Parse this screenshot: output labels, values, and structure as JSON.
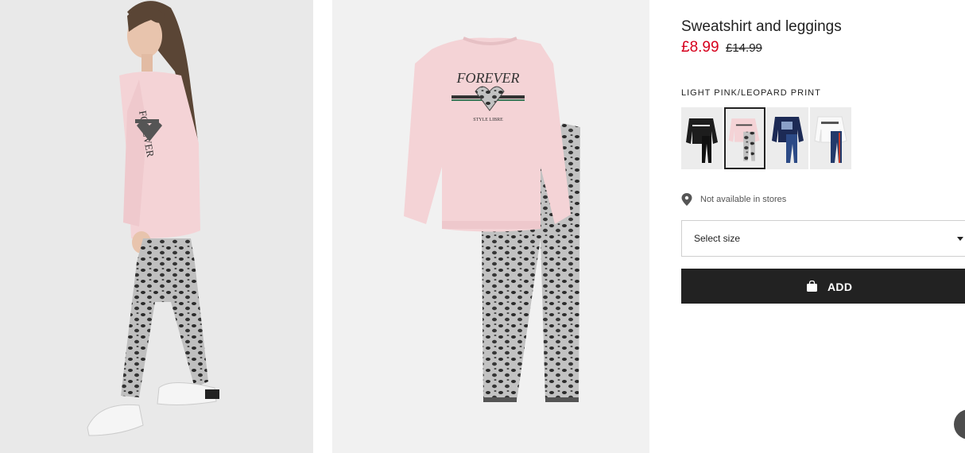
{
  "product": {
    "title": "Sweatshirt and leggings",
    "sale_price": "£8.99",
    "old_price": "£14.99",
    "colour_name": "LIGHT PINK/LEOPARD PRINT",
    "sweatshirt_print": "FOREVER",
    "sweatshirt_subprint": "STYLE LIBRE"
  },
  "swatches": [
    {
      "colour": "black",
      "selected": false
    },
    {
      "colour": "light pink/leopard print",
      "selected": true
    },
    {
      "colour": "navy",
      "selected": false
    },
    {
      "colour": "white",
      "selected": false
    }
  ],
  "availability": {
    "icon": "location-pin-icon",
    "text": "Not available in stores"
  },
  "size_select": {
    "label": "Select size",
    "icon": "chevron-down-icon"
  },
  "add_button": {
    "label": "ADD",
    "icon": "shopping-bag-icon"
  },
  "colors": {
    "sale": "#d6001c",
    "button": "#222222",
    "sweatshirt": "#f4d3d6"
  }
}
